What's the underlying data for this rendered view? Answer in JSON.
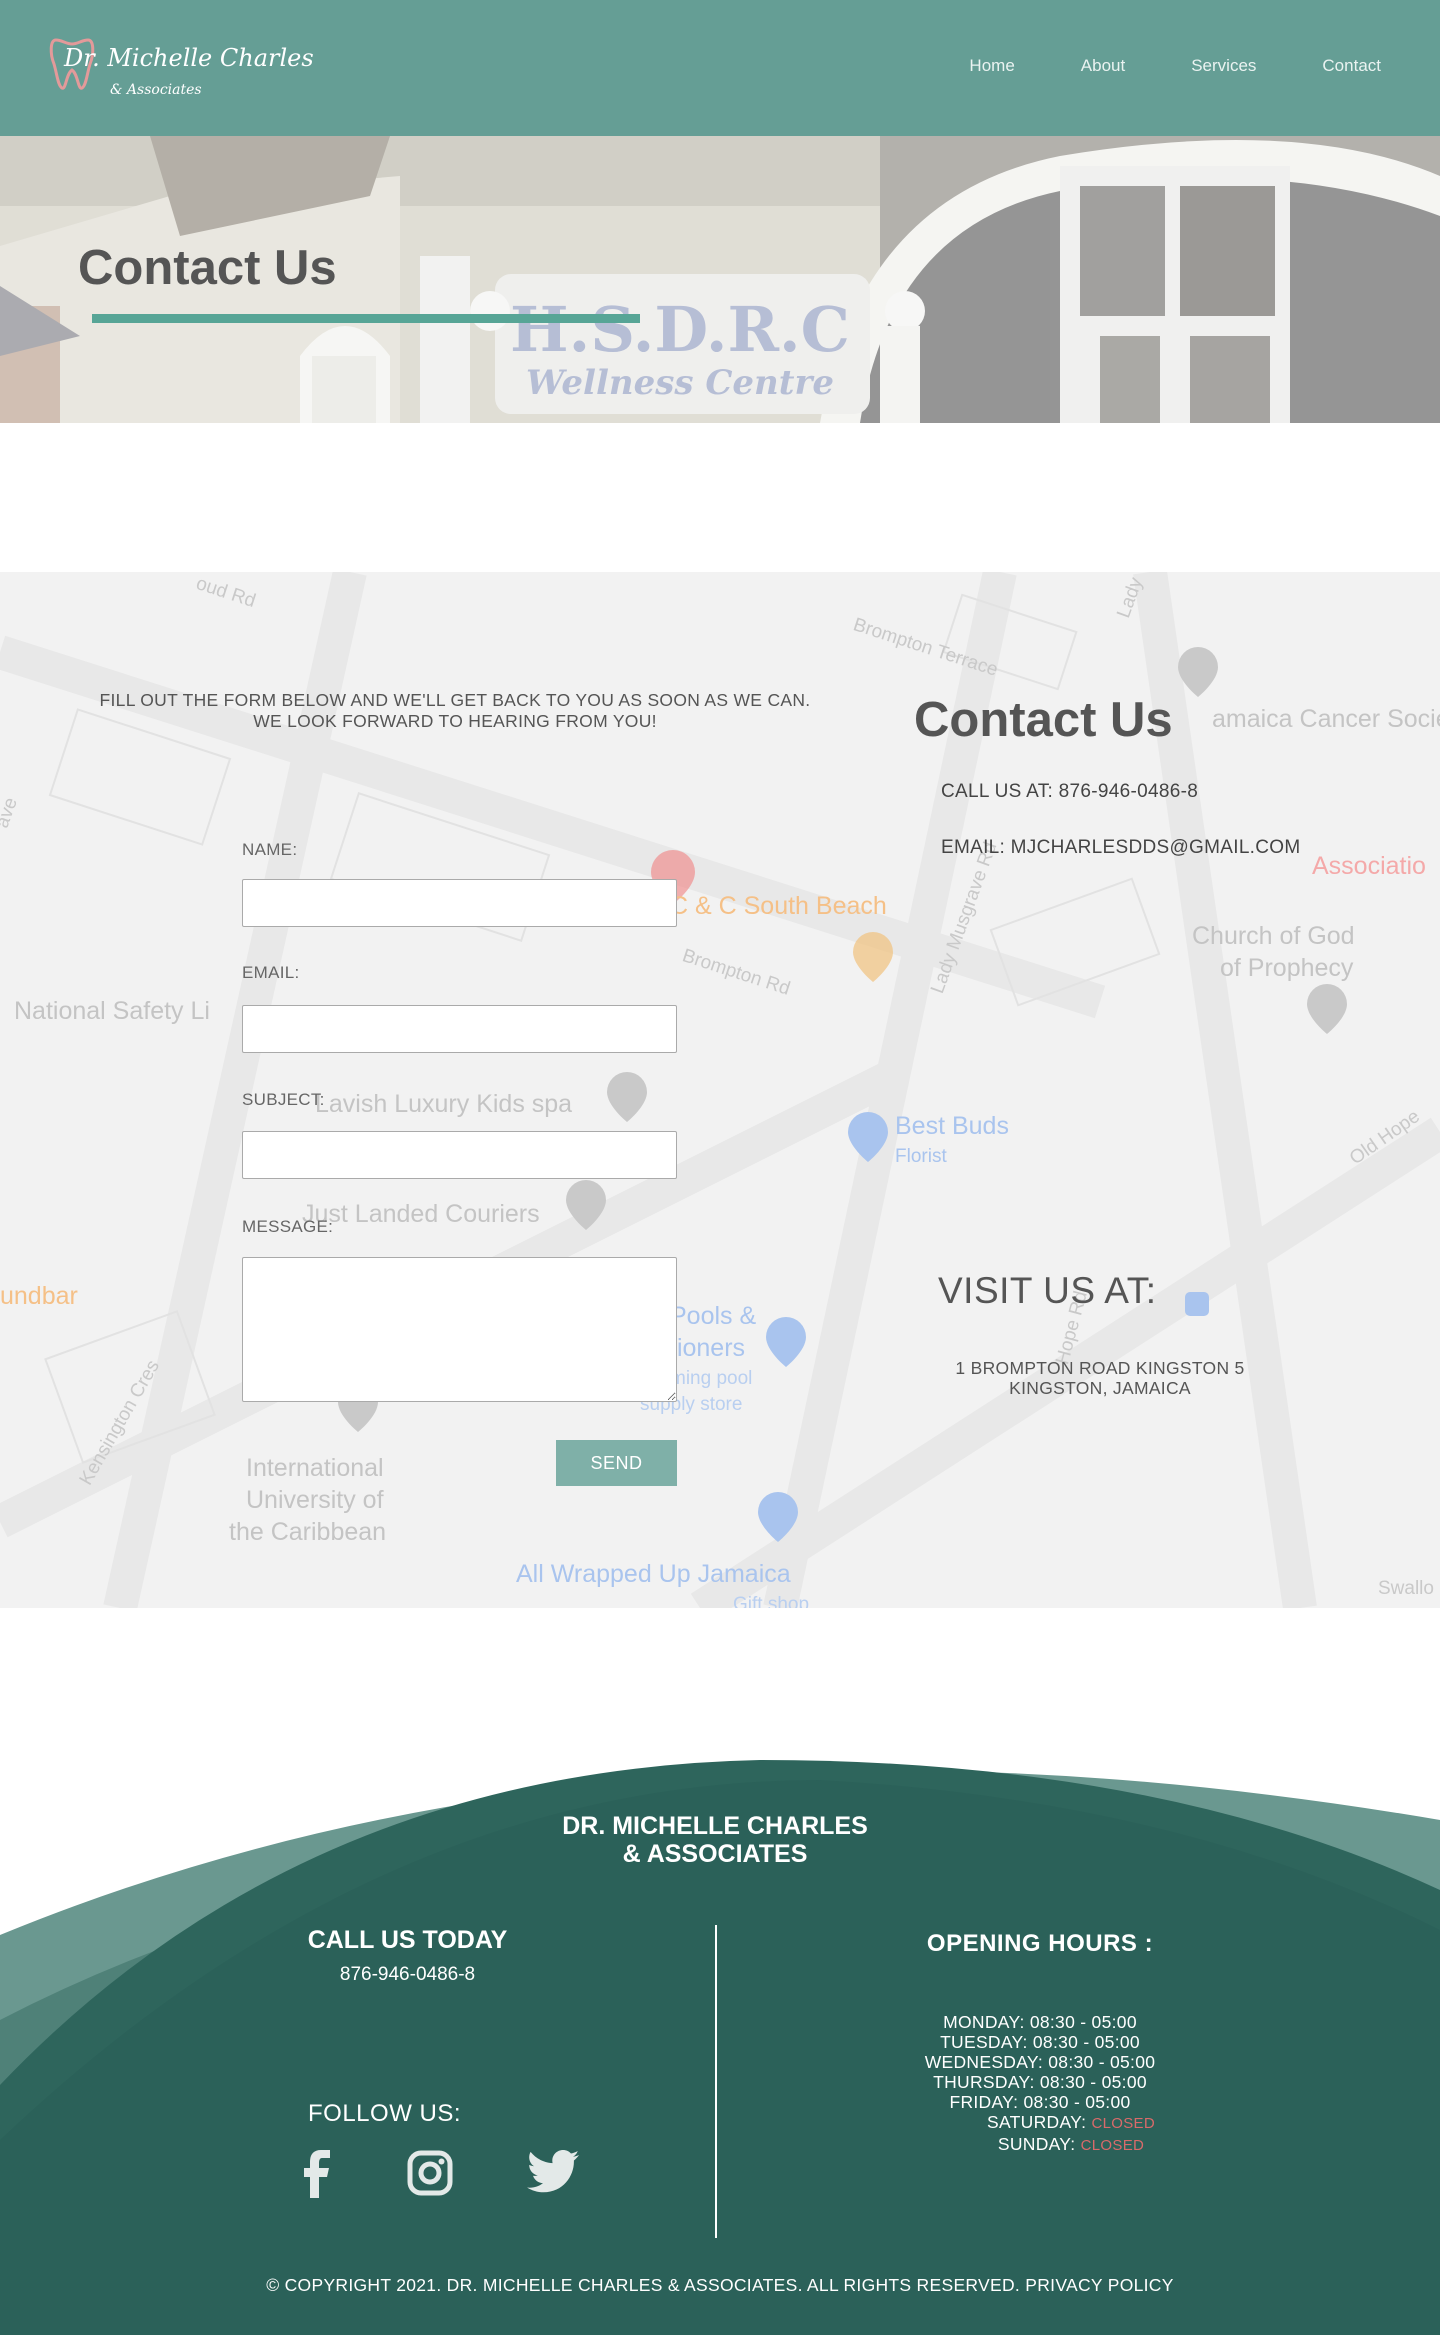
{
  "header": {
    "logo_name": "Dr. Michelle Charles",
    "logo_sub": "& Associates",
    "nav": [
      "Home",
      "About",
      "Services",
      "Contact"
    ]
  },
  "hero": {
    "title": "Contact Us",
    "sign_line1": "H.S.D.R.C",
    "sign_line2": "Wellness Centre"
  },
  "map": {
    "labels": [
      "Brompton Terrace",
      "amaica Cancer Society",
      "Associatio",
      "C & C South Beach",
      "Brompton Rd",
      "Lady Musgrave Rd",
      "Church of God",
      "of Prophecy",
      "National Safety Li",
      "Lavish Luxury Kids spa",
      "Best Buds",
      "Florist",
      "Just Landed Couriers",
      "undbar",
      "Pools &",
      "tioners",
      "ming pool",
      "supply store",
      "Kensington Cres",
      "International",
      "University of",
      "the Caribbean",
      "All Wrapped Up Jamaica",
      "Gift shop",
      "Old Hope",
      "Hope Rd",
      "Swallo",
      "Lady",
      "oud Rd",
      "ave"
    ]
  },
  "form": {
    "intro_line1": "FILL OUT THE FORM BELOW AND WE'LL GET BACK TO YOU AS SOON AS WE CAN.",
    "intro_line2": "WE LOOK FORWARD TO HEARING FROM YOU!",
    "name_label": "NAME:",
    "email_label": "EMAIL:",
    "subject_label": "SUBJECT:",
    "message_label": "MESSAGE:",
    "send_label": "SEND"
  },
  "contact": {
    "title": "Contact Us",
    "phone": "CALL US AT: 876-946-0486-8",
    "email": "EMAIL: MJCHARLESDDS@GMAIL.COM",
    "visit_title": "VISIT US AT:",
    "address_line1": "1 BROMPTON ROAD KINGSTON 5",
    "address_line2": "KINGSTON, JAMAICA"
  },
  "footer": {
    "brand_line1": "DR. MICHELLE CHARLES",
    "brand_line2": "& ASSOCIATES",
    "call_title": "CALL US TODAY",
    "call_number": "876-946-0486-8",
    "follow": "FOLLOW US:",
    "social_icons": [
      "facebook-icon",
      "instagram-icon",
      "twitter-icon"
    ],
    "hours_title": "OPENING HOURS :",
    "hours": [
      {
        "day": "MONDAY:",
        "time": "08:30 - 05:00"
      },
      {
        "day": "TUESDAY:",
        "time": "08:30 - 05:00"
      },
      {
        "day": "WEDNESDAY:",
        "time": "08:30 - 05:00"
      },
      {
        "day": "THURSDAY:",
        "time": "08:30 - 05:00"
      },
      {
        "day": "FRIDAY:",
        "time": "08:30 - 05:00"
      },
      {
        "day": "SATURDAY:",
        "time": "CLOSED"
      },
      {
        "day": "SUNDAY:",
        "time": "CLOSED"
      }
    ],
    "copyright": "© COPYRIGHT 2021. DR. MICHELLE CHARLES & ASSOCIATES. ALL RIGHTS RESERVED. PRIVACY POLICY"
  },
  "colors": {
    "header": "#659e95",
    "accent": "#57a596",
    "footer_dark": "#2b6159",
    "footer_light": "#6a9890",
    "send_button": "#7fb0a8",
    "closed": "#d96a6a"
  }
}
